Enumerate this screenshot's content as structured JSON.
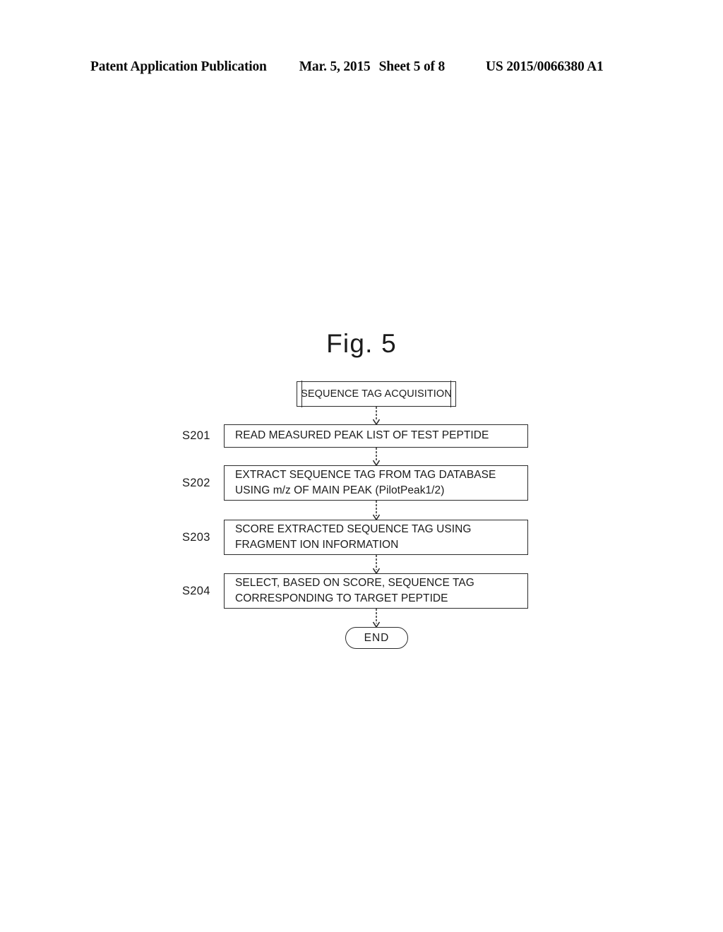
{
  "header": {
    "publication": "Patent Application Publication",
    "date": "Mar. 5, 2015",
    "sheet": "Sheet 5 of 8",
    "patent_number": "US 2015/0066380 A1"
  },
  "figure": {
    "title": "Fig. 5",
    "start_node": {
      "label": "SEQUENCE TAG ACQUISITION",
      "shape": "subroutine"
    },
    "steps": [
      {
        "id": "S201",
        "text": "READ MEASURED PEAK LIST OF TEST PEPTIDE"
      },
      {
        "id": "S202",
        "text": "EXTRACT SEQUENCE TAG FROM TAG DATABASE\nUSING m/z OF MAIN PEAK (PilotPeak1/2)"
      },
      {
        "id": "S203",
        "text": "SCORE EXTRACTED SEQUENCE TAG USING\nFRAGMENT ION INFORMATION"
      },
      {
        "id": "S204",
        "text": "SELECT, BASED ON SCORE, SEQUENCE TAG\nCORRESPONDING TO TARGET PEPTIDE"
      }
    ],
    "end_node": {
      "label": "END",
      "shape": "terminator"
    },
    "line_color": "#2b2b2b",
    "background_color": "#ffffff"
  }
}
